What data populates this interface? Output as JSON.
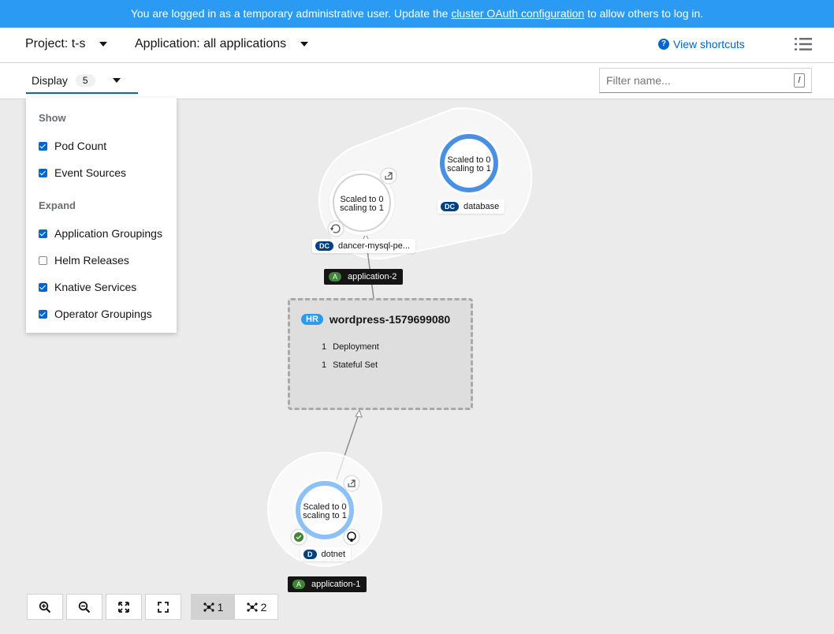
{
  "banner": {
    "text_before": "You are logged in as a temporary administrative user. Update the ",
    "link": "cluster OAuth configuration",
    "text_after": " to allow others to log in."
  },
  "header": {
    "project": "Project: t-s",
    "application": "Application: all applications",
    "shortcuts": "View shortcuts",
    "shortcuts_icon": "question-circle-icon",
    "list_icon": "list-view-icon"
  },
  "toolbar": {
    "display_label": "Display",
    "display_count": "5",
    "filter_placeholder": "Filter name...",
    "filter_shortcut": "/"
  },
  "display_panel": {
    "show_title": "Show",
    "show_items": [
      {
        "label": "Pod Count",
        "checked": true
      },
      {
        "label": "Event Sources",
        "checked": true
      }
    ],
    "expand_title": "Expand",
    "expand_items": [
      {
        "label": "Application Groupings",
        "checked": true
      },
      {
        "label": "Helm Releases",
        "checked": false
      },
      {
        "label": "Knative Services",
        "checked": true
      },
      {
        "label": "Operator Groupings",
        "checked": true
      }
    ]
  },
  "topology": {
    "application_2": {
      "label": "application-2",
      "badge": "A",
      "nodes": [
        {
          "kind": "DC",
          "name": "dancer-mysql-pe...",
          "status_line1": "Scaled to 0",
          "status_line2": "scaling to 1"
        },
        {
          "kind": "DC",
          "name": "database",
          "status_line1": "Scaled to 0",
          "status_line2": "scaling to 1"
        }
      ]
    },
    "helm_release": {
      "badge": "HR",
      "name": "wordpress-1579699080",
      "resources": [
        {
          "count": "1",
          "type": "Deployment"
        },
        {
          "count": "1",
          "type": "Stateful Set"
        }
      ]
    },
    "application_1": {
      "label": "application-1",
      "badge": "A",
      "node": {
        "kind": "D",
        "name": "dotnet",
        "status_line1": "Scaled to 0",
        "status_line2": "scaling to 1"
      }
    }
  },
  "controls": {
    "zoom_in_icon": "zoom-in-icon",
    "zoom_out_icon": "zoom-out-icon",
    "fit_icon": "fit-to-screen-icon",
    "reset_icon": "expand-icon",
    "layout1": "1",
    "layout2": "2"
  },
  "colors": {
    "banner": "#2b9af3",
    "link": "#0066cc",
    "pod_ring": "#4a90e2",
    "pod_ring_light": "#8bc1f7",
    "app_badge": "#3e8635"
  }
}
